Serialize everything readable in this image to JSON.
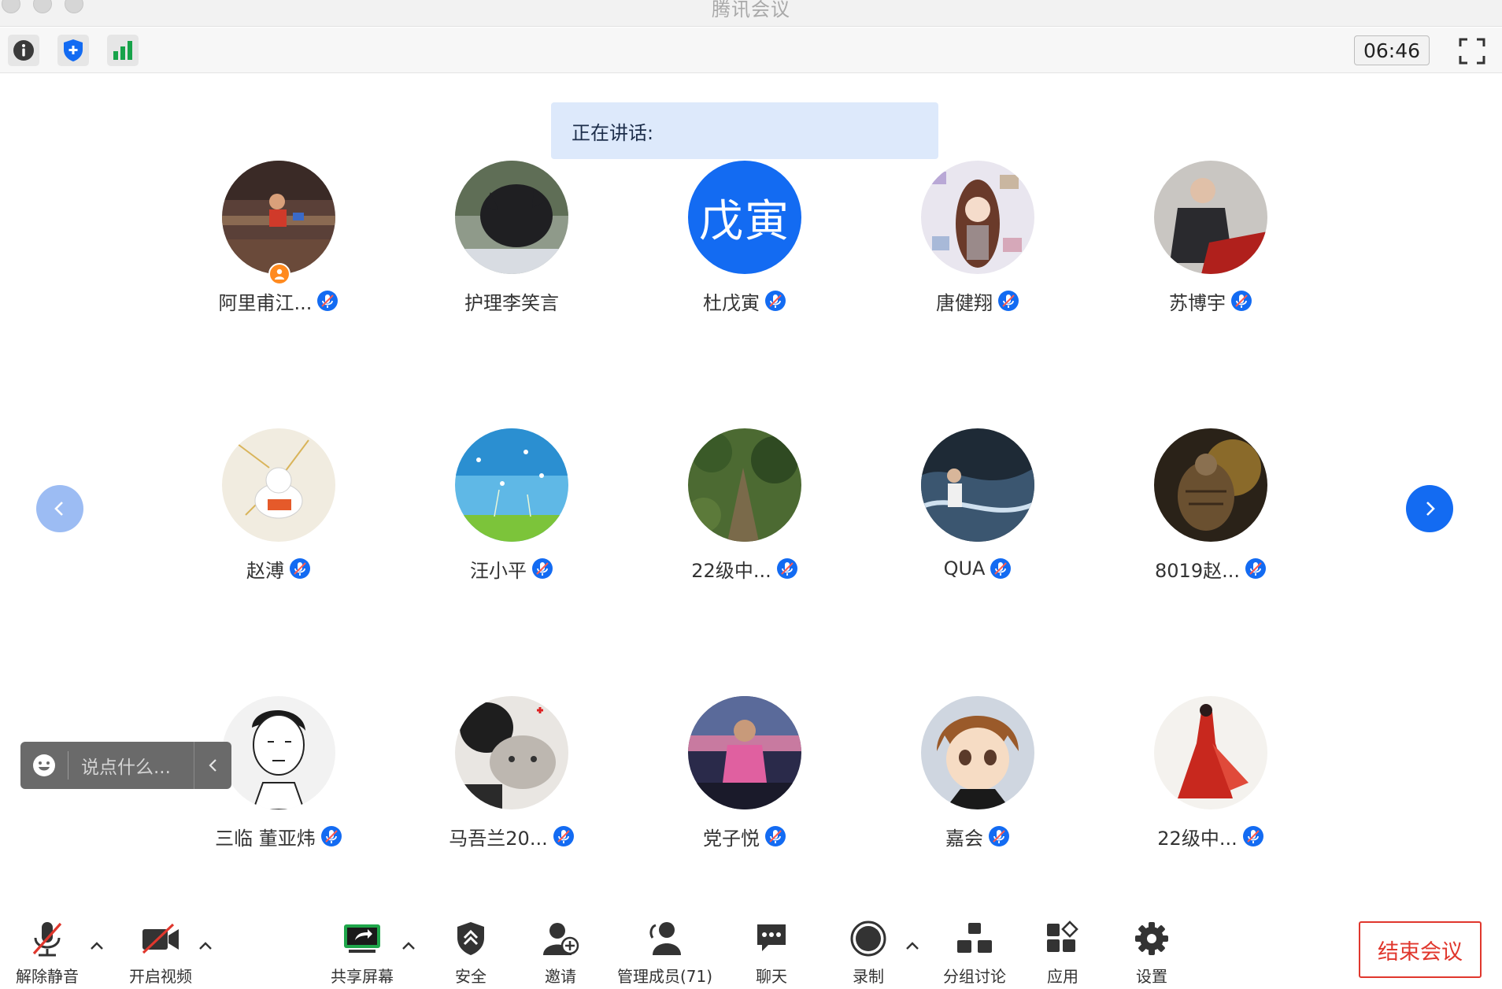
{
  "window": {
    "title": "腾讯会议"
  },
  "toolbar": {
    "timer": "06:46"
  },
  "speaking": {
    "label": "正在讲话:"
  },
  "participants": [
    {
      "name": "阿里甫江...",
      "host": true
    },
    {
      "name": "护理李笑言"
    },
    {
      "name": "杜戊寅",
      "initials": "戊寅",
      "initials_color": "#136bf2"
    },
    {
      "name": "唐健翔"
    },
    {
      "name": "苏博宇"
    },
    {
      "name": "赵溥"
    },
    {
      "name": "汪小平"
    },
    {
      "name": "22级中..."
    },
    {
      "name": "QUA"
    },
    {
      "name": "8019赵..."
    },
    {
      "name": "三临 董亚炜"
    },
    {
      "name": "马吾兰20..."
    },
    {
      "name": "党子悦"
    },
    {
      "name": "嘉会"
    },
    {
      "name": "22级中..."
    }
  ],
  "chat": {
    "placeholder": "说点什么..."
  },
  "bottom": {
    "unmute": "解除静音",
    "video": "开启视频",
    "share": "共享屏幕",
    "security": "安全",
    "invite": "邀请",
    "members": "管理成员(71)",
    "chat": "聊天",
    "record": "录制",
    "breakout": "分组讨论",
    "apps": "应用",
    "settings": "设置",
    "end": "结束会议"
  },
  "colors": {
    "accent": "#136bf2",
    "danger": "#e0372d",
    "host_badge": "#ff8a1f"
  }
}
